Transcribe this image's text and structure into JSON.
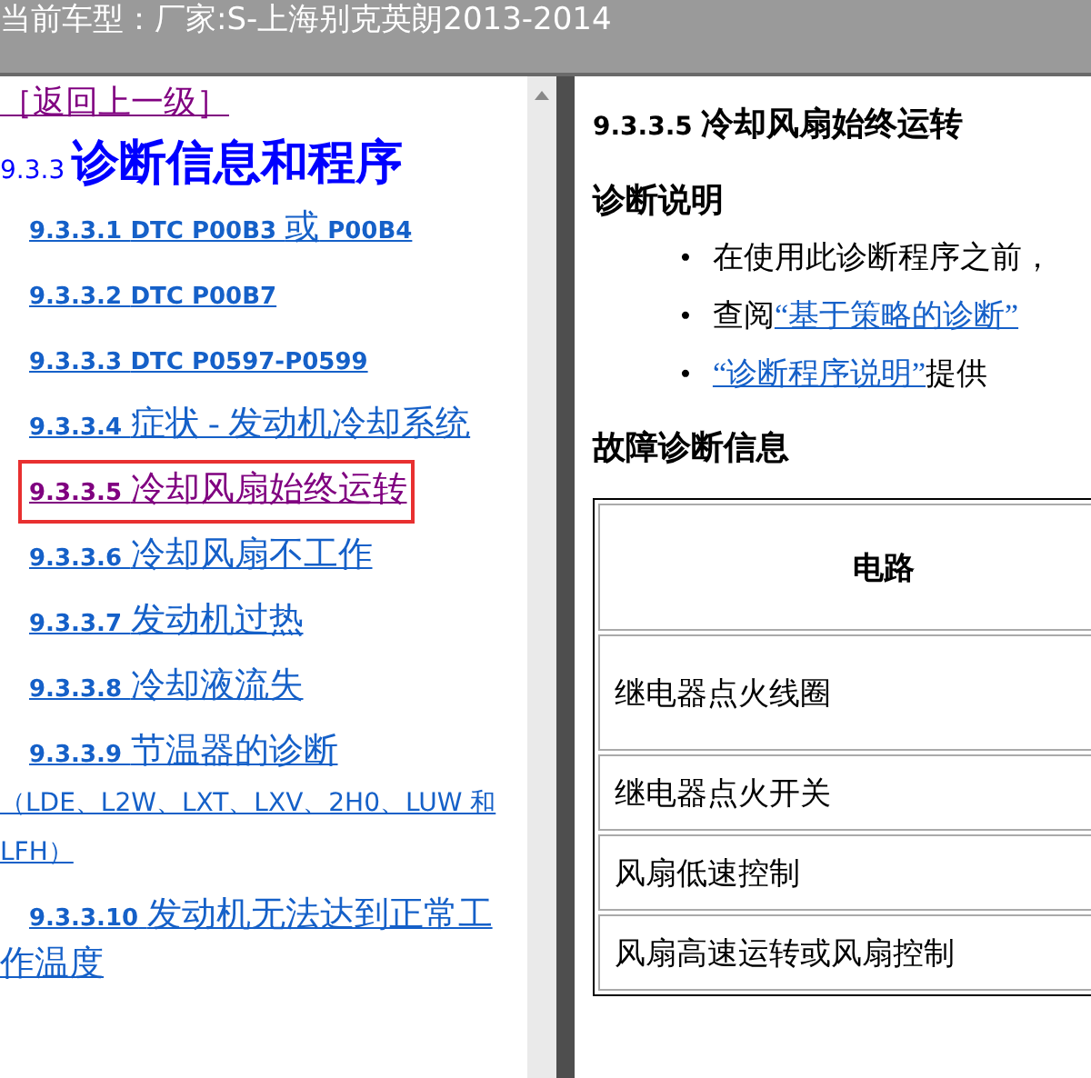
{
  "title_bar": {
    "text": "当前车型：厂家:S-上海别克英朗2013-2014"
  },
  "nav": {
    "back_link": "［返回上一级］",
    "heading_number": "9.3.3",
    "heading_title": "诊断信息和程序",
    "items": [
      {
        "kind": "code",
        "number": "9.3.3.1",
        "title": "DTC P00B3 ",
        "title_cjk": "或",
        "title_tail": " P00B4",
        "selected": false
      },
      {
        "kind": "code",
        "number": "9.3.3.2",
        "title": "DTC P00B7",
        "selected": false
      },
      {
        "kind": "code",
        "number": "9.3.3.3",
        "title": "DTC P0597-P0599",
        "selected": false
      },
      {
        "kind": "topic",
        "number": "9.3.3.4",
        "title": "症状 - 发动机冷却系统",
        "selected": false
      },
      {
        "kind": "topic",
        "number": "9.3.3.5",
        "title": "冷却风扇始终运转",
        "selected": true
      },
      {
        "kind": "topic",
        "number": "9.3.3.6",
        "title": "冷却风扇不工作",
        "selected": false
      },
      {
        "kind": "topic",
        "number": "9.3.3.7",
        "title": "发动机过热",
        "selected": false
      },
      {
        "kind": "topic",
        "number": "9.3.3.8",
        "title": "冷却液流失",
        "selected": false
      },
      {
        "kind": "topic",
        "number": "9.3.3.9",
        "title": "节温器的诊断",
        "note": "（LDE、L2W、LXT、LXV、2H0、LUW 和 LFH）",
        "selected": false
      },
      {
        "kind": "topic",
        "number": "9.3.3.10",
        "title": "发动机无法达到正常工作温度",
        "selected": false
      }
    ]
  },
  "content": {
    "heading_number": "9.3.3.5",
    "heading_title": "冷却风扇始终运转",
    "section_1": "诊断说明",
    "bullets": [
      {
        "marker": "•",
        "text": "在使用此诊断程序之前，"
      },
      {
        "marker": "•",
        "text": "查阅",
        "link": "“基于策略的诊断”"
      },
      {
        "marker": "•",
        "link": "“诊断程序说明”",
        "text_after": "提供"
      }
    ],
    "section_2": "故障诊断信息",
    "table": {
      "column_1": "电路",
      "rows": [
        "继电器点火线圈",
        "继电器点火开关",
        "风扇低速控制",
        "风扇高速运转或风扇控制"
      ]
    }
  }
}
